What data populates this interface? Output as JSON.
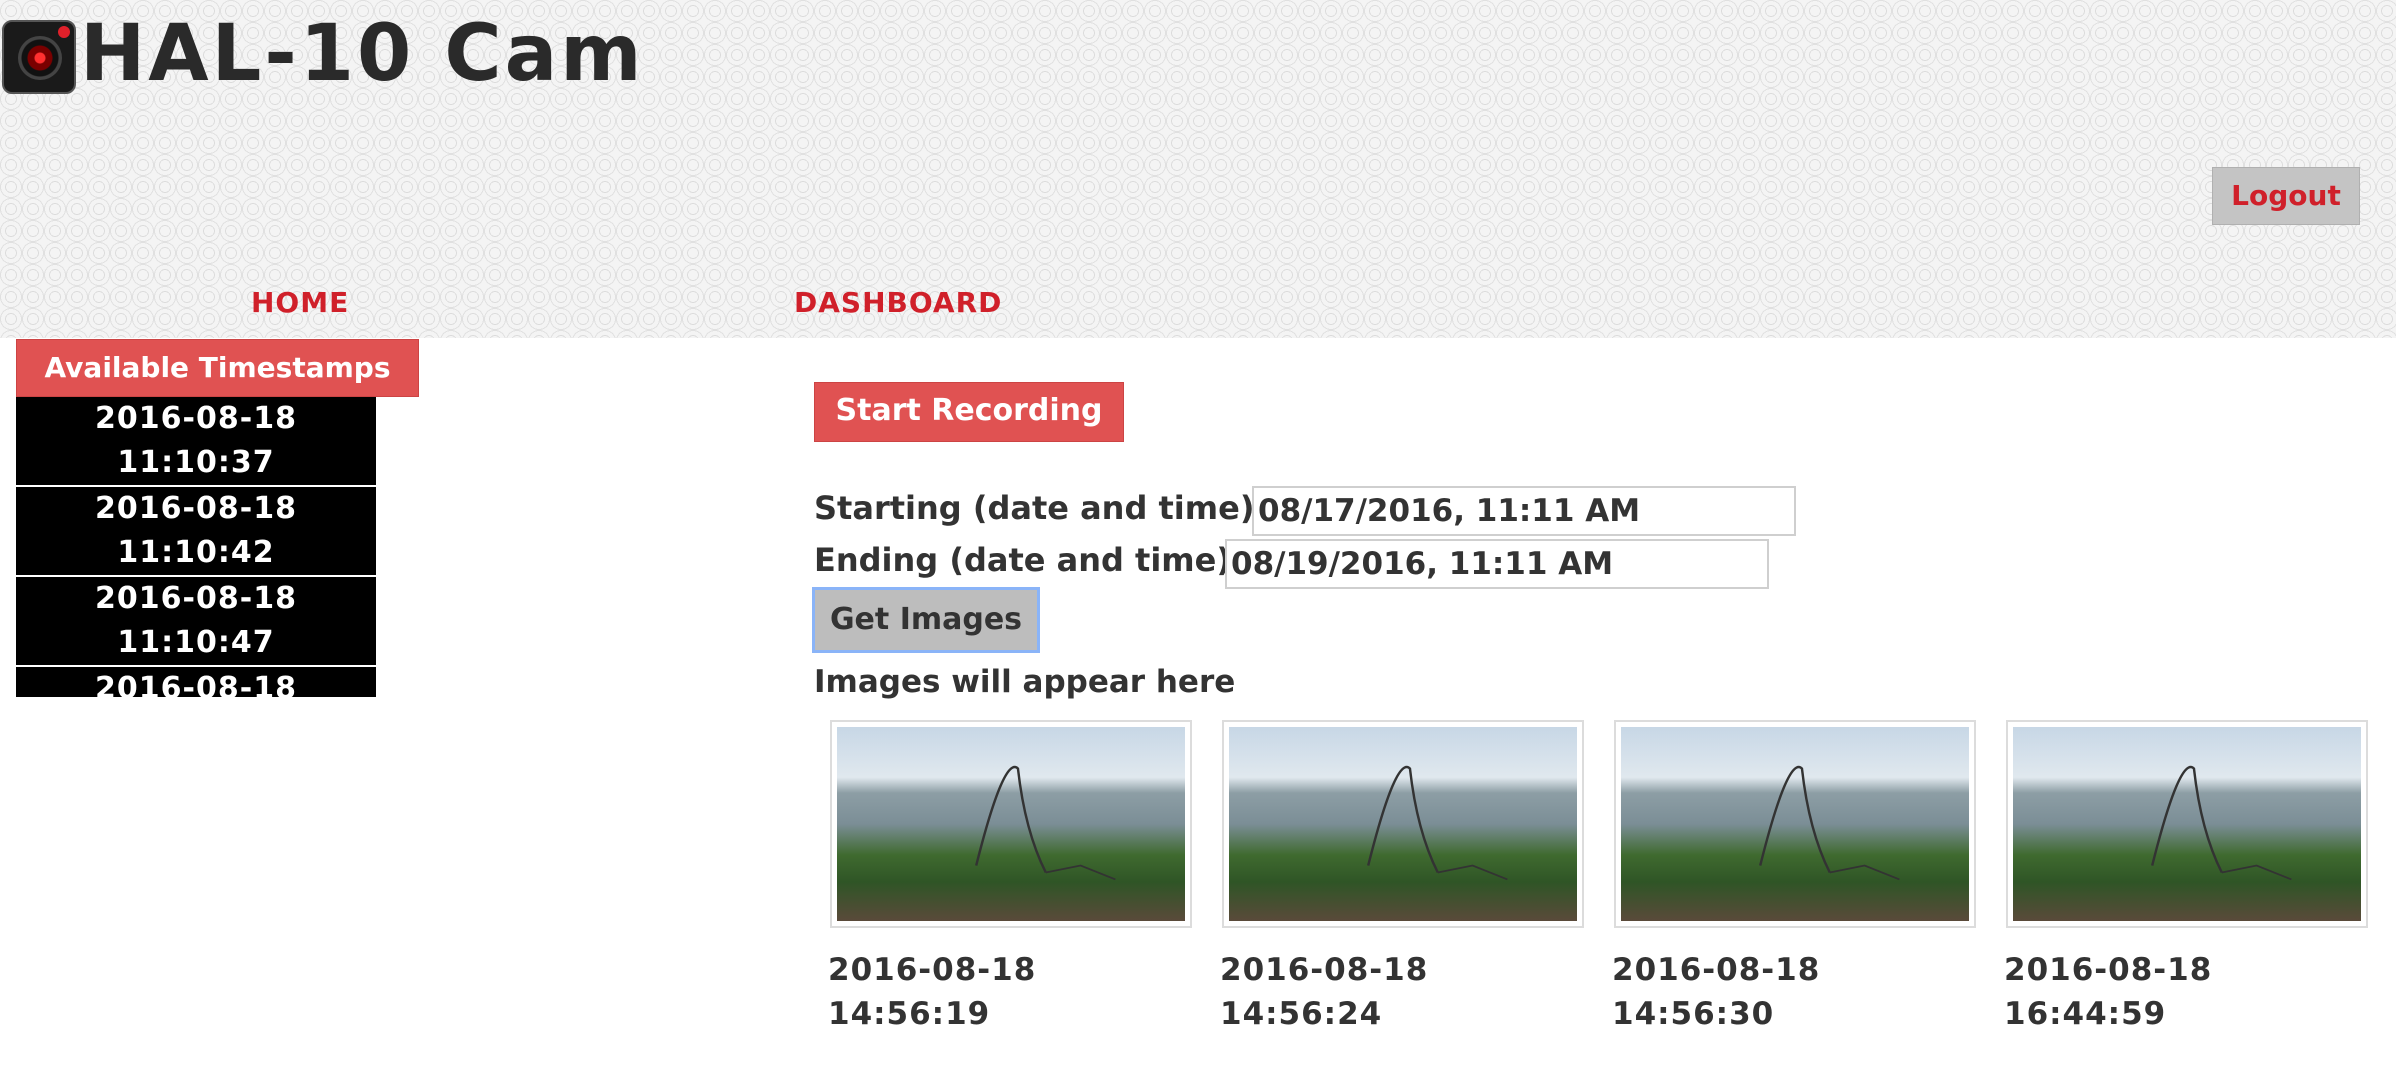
{
  "app": {
    "title": "HAL-10 Cam",
    "logo_icon": "camera-lens-icon"
  },
  "header": {
    "logout_label": "Logout"
  },
  "nav": {
    "home": "HOME",
    "dashboard": "DASHBOARD"
  },
  "colors": {
    "accent": "#e05252",
    "link": "#d0202a",
    "text": "#333333"
  },
  "sidebar": {
    "title": "Available Timestamps",
    "timestamps": [
      "2016-08-18\n11:10:37",
      "2016-08-18\n11:10:42",
      "2016-08-18\n11:10:47",
      "2016-08-18"
    ]
  },
  "controls": {
    "start_recording": "Start Recording",
    "start_label": "Starting (date and time):",
    "start_value": "08/17/2016, 11:11 AM",
    "end_label": "Ending (date and time):",
    "end_value": "08/19/2016, 11:11 AM",
    "get_images": "Get Images",
    "images_placeholder": "Images will appear here"
  },
  "images": [
    {
      "caption": "2016-08-18\n14:56:19"
    },
    {
      "caption": "2016-08-18\n14:56:24"
    },
    {
      "caption": "2016-08-18\n14:56:30"
    },
    {
      "caption": "2016-08-18\n16:44:59"
    }
  ]
}
